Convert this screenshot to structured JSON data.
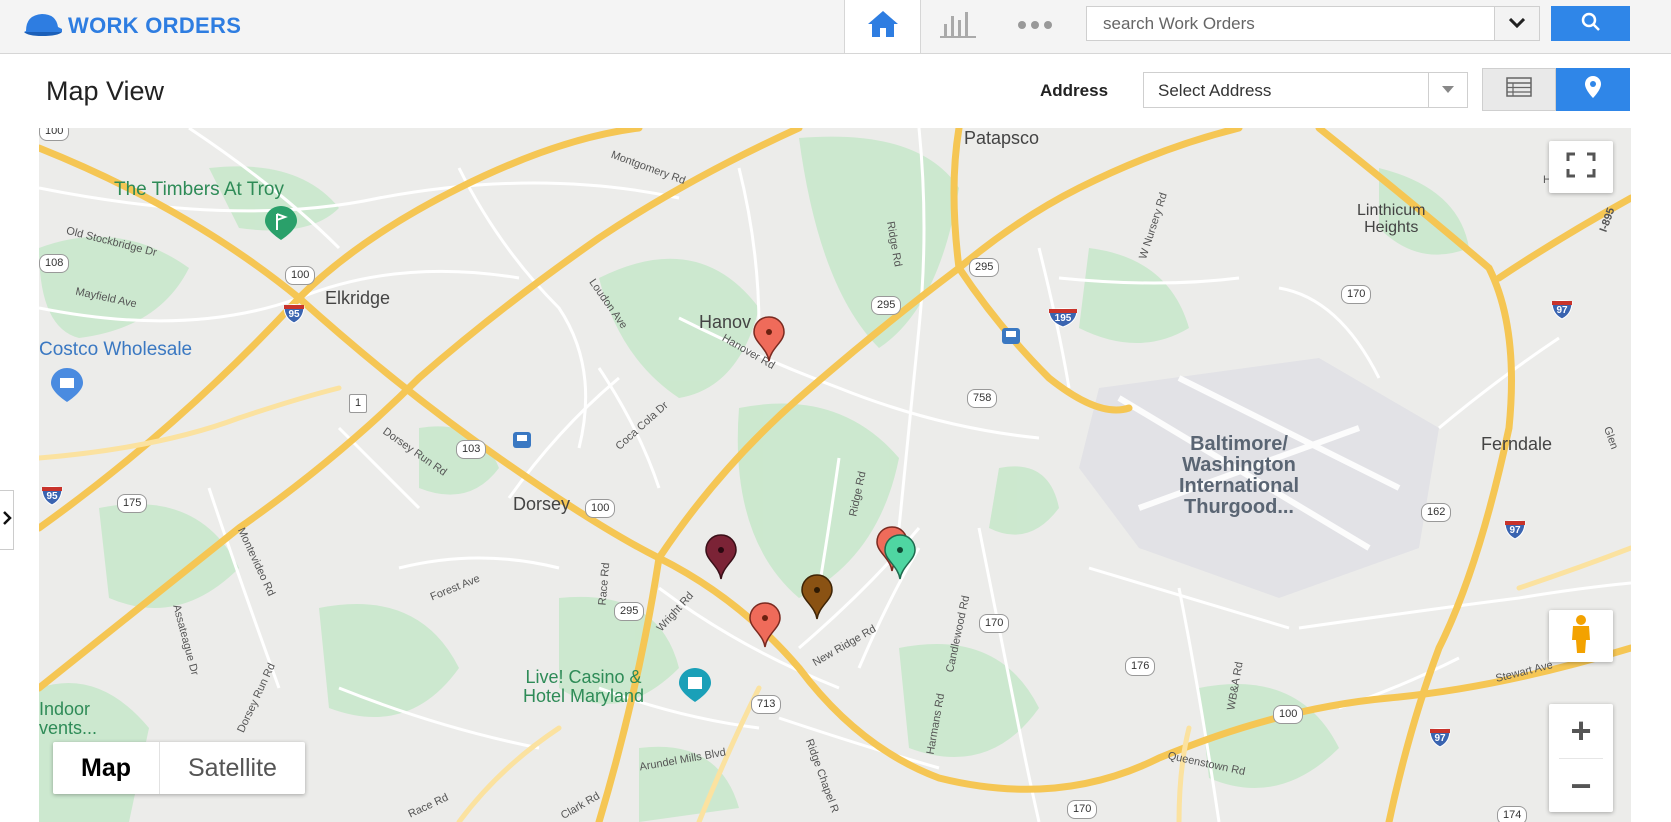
{
  "app": {
    "title": "WORK ORDERS",
    "brand_color": "#2e7de1",
    "logo_icon": "hardhat-icon"
  },
  "nav": {
    "home_icon": "home-icon",
    "charts_icon": "bar-chart-icon",
    "more_icon": "more-dots-icon"
  },
  "search": {
    "placeholder": "search Work Orders",
    "button_icon": "search-icon"
  },
  "page": {
    "title": "Map View"
  },
  "address": {
    "label": "Address",
    "value": "Select Address"
  },
  "view_toggle": {
    "list_icon": "list-view-icon",
    "map_icon": "map-pin-icon",
    "active": "map"
  },
  "map": {
    "places": {
      "patapsco": "Patapsco",
      "linthicum": "Linthicum\nHeights",
      "elkridge": "Elkridge",
      "hanover": "Hanov",
      "dorsey": "Dorsey",
      "ferndale": "Ferndale",
      "airport": "Baltimore/\nWashington\nInternational\nThurgood...",
      "timbers": "The Timbers At Troy",
      "costco": "Costco Wholesale",
      "casino": "Live! Casino &\nHotel Maryland",
      "indoor": "Indoor\nvents..."
    },
    "roads": {
      "montgomery": "Montgomery Rd",
      "old_stockbridge": "Old Stockbridge Dr",
      "mayfield": "Mayfield Ave",
      "loudon": "Loudon Ave",
      "hanover_rd": "Hanover Rd",
      "coca_cola": "Coca Cola Dr",
      "dorsey_run": "Dorsey Run Rd",
      "montevideo": "Montevideo Rd",
      "forest": "Forest Ave",
      "race": "Race Rd",
      "wright": "Wright Rd",
      "ridge": "Ridge Rd",
      "ridge2": "Ridge Rd",
      "new_ridge": "New Ridge Rd",
      "candlewood": "Candlewood Rd",
      "harmans": "Harmans Rd",
      "arundel": "Arundel Mills Blvd",
      "ridge_chapel": "Ridge Chapel R",
      "clark": "Clark Rd",
      "race2": "Race Rd",
      "assateague": "Assateague Dr",
      "dorsey_run2": "Dorsey Run Rd",
      "queenstown": "Queenstown Rd",
      "wba": "WB&A Rd",
      "stewart": "Stewart Ave",
      "nursery": "W Nursery Rd",
      "ham": "Ham",
      "i895": "I-895",
      "glen": "Glen"
    },
    "shields": {
      "s100a": "100",
      "s108": "108",
      "s103": "103",
      "s175": "175",
      "s100b": "100",
      "s295a": "295",
      "s295b": "295",
      "s295c": "295",
      "s758": "758",
      "s170a": "170",
      "s170b": "170",
      "s170c": "170",
      "s176": "176",
      "s162": "162",
      "s100c": "100",
      "s713": "713",
      "s174": "174",
      "s1": "1",
      "s100top": "100"
    },
    "interstates": {
      "i95a": "95",
      "i95b": "95",
      "i195": "195",
      "i97a": "97",
      "i97b": "97",
      "i97c": "97"
    },
    "markers": [
      {
        "color": "#ef6b5a",
        "label": "work-order-marker"
      },
      {
        "color": "#7b2336",
        "label": "work-order-marker"
      },
      {
        "color": "#8a5213",
        "label": "work-order-marker"
      },
      {
        "color": "#ef6b5a",
        "label": "work-order-marker"
      },
      {
        "color": "#ef6b5a",
        "label": "work-order-marker"
      },
      {
        "color": "#4fd6a2",
        "label": "work-order-marker"
      }
    ],
    "controls": {
      "fullscreen_icon": "fullscreen-icon",
      "pegman_icon": "street-view-pegman-icon",
      "zoom_in": "+",
      "zoom_out": "−",
      "map_type_map": "Map",
      "map_type_satellite": "Satellite"
    }
  },
  "side_panel": {
    "toggle_icon": "chevron-right-icon"
  }
}
